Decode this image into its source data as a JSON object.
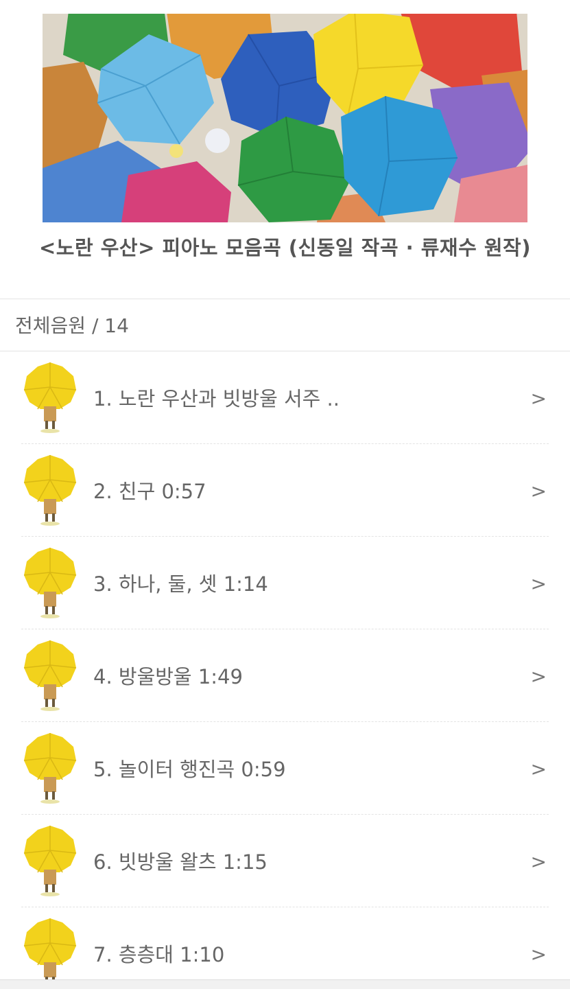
{
  "album": {
    "title": "<노란 우산> 피아노 모음곡 (신동일 작곡 · 류재수 원작)"
  },
  "section": {
    "label": "전체음원 / 14"
  },
  "tracks": [
    {
      "label": "1. 노란 우산과 빗방울 서주 .."
    },
    {
      "label": "2. 친구 0:57"
    },
    {
      "label": "3. 하나, 둘, 셋 1:14"
    },
    {
      "label": "4. 방울방울 1:49"
    },
    {
      "label": "5. 놀이터 행진곡 0:59"
    },
    {
      "label": "6. 빗방울 왈츠 1:15"
    },
    {
      "label": "7. 층층대 1:10"
    }
  ],
  "icons": {
    "chevron": ">",
    "thumbnail": "yellow-umbrella-icon"
  },
  "colors": {
    "text": "#555555",
    "umbrella_yellow": "#f2d21c",
    "divider": "#e3e3e3"
  }
}
